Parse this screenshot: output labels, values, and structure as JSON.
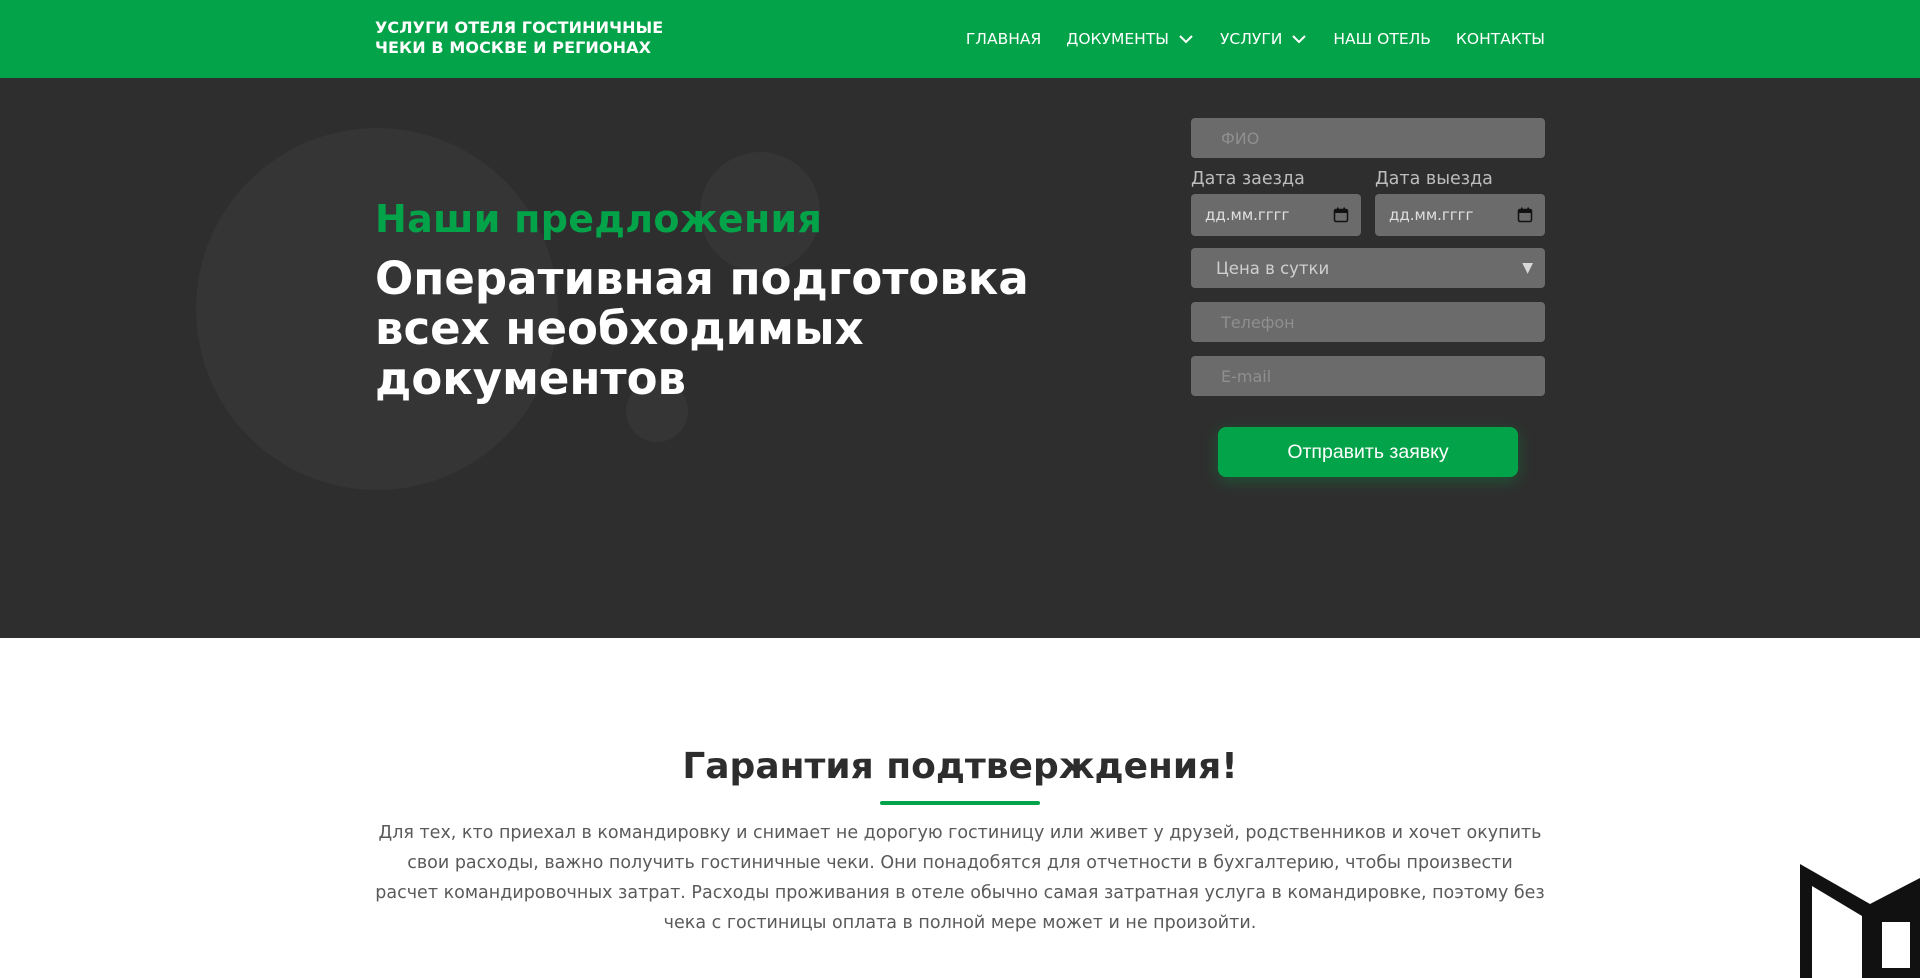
{
  "header": {
    "logo_line1": "УСЛУГИ ОТЕЛЯ ГОСТИНИЧНЫЕ",
    "logo_line2": "ЧЕКИ В МОСКВЕ И РЕГИОНАХ",
    "nav": {
      "home": "ГЛАВНАЯ",
      "documents": "ДОКУМЕНТЫ",
      "services": "УСЛУГИ",
      "hotel": "НАШ ОТЕЛЬ",
      "contacts": "КОНТАКТЫ"
    }
  },
  "hero": {
    "eyebrow": "Наши предложения",
    "title_line1": "Оперативная подготовка",
    "title_line2": "всех необходимых",
    "title_line3": "документов"
  },
  "form": {
    "name_placeholder": "ФИО",
    "checkin_label": "Дата заезда",
    "checkout_label": "Дата выезда",
    "date_placeholder": "дд.мм.гггг",
    "price_select": "Цена в сутки",
    "phone_placeholder": "Телефон",
    "email_placeholder": "E-mail",
    "submit": "Отправить заявку"
  },
  "guarantee": {
    "title": "Гарантия подтверждения!",
    "text": "Для тех, кто приехал в командировку и снимает не дорогую гостиницу или живет у друзей, родственников и хочет окупить свои расходы, важно получить гостиничные чеки. Они понадобятся для отчетности в бухгалтерию, чтобы произвести расчет командировочных затрат. Расходы проживания в отеле обычно самая затратная услуга в командировке, поэтому без чека с гостиницы оплата в полной мере может и не произойти."
  },
  "colors": {
    "brand_green": "#03a349",
    "hero_bg": "#2e2e2e",
    "field_bg": "#6b6b6b"
  },
  "icons": {
    "chevron": "chevron-down-icon",
    "calendar": "calendar-icon",
    "select_arrow": "triangle-down-icon",
    "corner_logo": "brand-logo-icon"
  }
}
